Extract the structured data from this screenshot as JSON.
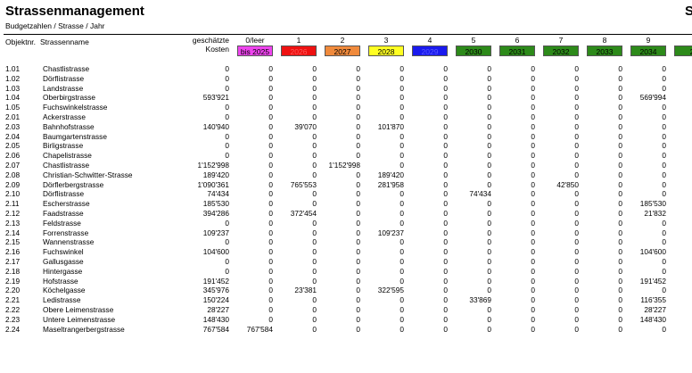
{
  "header": {
    "title": "Strassenmanagement",
    "title_right": "S",
    "subtitle": "Budgetzahlen / Strasse / Jahr"
  },
  "columns": {
    "objnr": "Objektnr.",
    "name": "Strassenname",
    "cost_line1": "geschätzte",
    "cost_line2": "Kosten",
    "periods": [
      {
        "num": "0/leer",
        "year": "bis 2025",
        "color": "#ee44ee",
        "text_color": "#000000"
      },
      {
        "num": "1",
        "year": "2026",
        "color": "#ee1111",
        "text_color": "#ff5a5a"
      },
      {
        "num": "2",
        "year": "2027",
        "color": "#f08a3c",
        "text_color": "#000000"
      },
      {
        "num": "3",
        "year": "2028",
        "color": "#ffff22",
        "text_color": "#000000"
      },
      {
        "num": "4",
        "year": "2029",
        "color": "#1a1aee",
        "text_color": "#5a5aff"
      },
      {
        "num": "5",
        "year": "2030",
        "color": "#2d8a1a",
        "text_color": "#000000"
      },
      {
        "num": "6",
        "year": "2031",
        "color": "#2d8a1a",
        "text_color": "#000000"
      },
      {
        "num": "7",
        "year": "2032",
        "color": "#2d8a1a",
        "text_color": "#000000"
      },
      {
        "num": "8",
        "year": "2033",
        "color": "#2d8a1a",
        "text_color": "#000000"
      },
      {
        "num": "9",
        "year": "2034",
        "color": "#2d8a1a",
        "text_color": "#000000"
      },
      {
        "num": "",
        "year": "2",
        "color": "#2d8a1a",
        "text_color": "#000000"
      }
    ]
  },
  "rows": [
    {
      "nr": "1.01",
      "name": "Chastlistrasse",
      "cost": "0",
      "v": [
        "0",
        "0",
        "0",
        "0",
        "0",
        "0",
        "0",
        "0",
        "0",
        "0"
      ]
    },
    {
      "nr": "1.02",
      "name": "Dörflistrasse",
      "cost": "0",
      "v": [
        "0",
        "0",
        "0",
        "0",
        "0",
        "0",
        "0",
        "0",
        "0",
        "0"
      ]
    },
    {
      "nr": "1.03",
      "name": "Landstrasse",
      "cost": "0",
      "v": [
        "0",
        "0",
        "0",
        "0",
        "0",
        "0",
        "0",
        "0",
        "0",
        "0"
      ]
    },
    {
      "nr": "1.04",
      "name": "Oberbirgstrasse",
      "cost": "593'921",
      "v": [
        "0",
        "0",
        "0",
        "0",
        "0",
        "0",
        "0",
        "0",
        "0",
        "569'994"
      ]
    },
    {
      "nr": "1.05",
      "name": "Fuchswinkelstrasse",
      "cost": "0",
      "v": [
        "0",
        "0",
        "0",
        "0",
        "0",
        "0",
        "0",
        "0",
        "0",
        "0"
      ]
    },
    {
      "nr": "2.01",
      "name": "Ackerstrasse",
      "cost": "0",
      "v": [
        "0",
        "0",
        "0",
        "0",
        "0",
        "0",
        "0",
        "0",
        "0",
        "0"
      ]
    },
    {
      "nr": "2.03",
      "name": "Bahnhofstrasse",
      "cost": "140'940",
      "v": [
        "0",
        "39'070",
        "0",
        "101'870",
        "0",
        "0",
        "0",
        "0",
        "0",
        "0"
      ]
    },
    {
      "nr": "2.04",
      "name": "Baumgartenstrasse",
      "cost": "0",
      "v": [
        "0",
        "0",
        "0",
        "0",
        "0",
        "0",
        "0",
        "0",
        "0",
        "0"
      ]
    },
    {
      "nr": "2.05",
      "name": "Birligstrasse",
      "cost": "0",
      "v": [
        "0",
        "0",
        "0",
        "0",
        "0",
        "0",
        "0",
        "0",
        "0",
        "0"
      ]
    },
    {
      "nr": "2.06",
      "name": "Chapelistrasse",
      "cost": "0",
      "v": [
        "0",
        "0",
        "0",
        "0",
        "0",
        "0",
        "0",
        "0",
        "0",
        "0"
      ]
    },
    {
      "nr": "2.07",
      "name": "Chastlistrasse",
      "cost": "1'152'998",
      "v": [
        "0",
        "0",
        "1'152'998",
        "0",
        "0",
        "0",
        "0",
        "0",
        "0",
        "0"
      ]
    },
    {
      "nr": "2.08",
      "name": "Christian-Schwitter-Strasse",
      "cost": "189'420",
      "v": [
        "0",
        "0",
        "0",
        "189'420",
        "0",
        "0",
        "0",
        "0",
        "0",
        "0"
      ]
    },
    {
      "nr": "2.09",
      "name": "Dörflerbergstrasse",
      "cost": "1'090'361",
      "v": [
        "0",
        "765'553",
        "0",
        "281'958",
        "0",
        "0",
        "0",
        "42'850",
        "0",
        "0"
      ]
    },
    {
      "nr": "2.10",
      "name": "Dörflistrasse",
      "cost": "74'434",
      "v": [
        "0",
        "0",
        "0",
        "0",
        "0",
        "74'434",
        "0",
        "0",
        "0",
        "0"
      ]
    },
    {
      "nr": "2.11",
      "name": "Escherstrasse",
      "cost": "185'530",
      "v": [
        "0",
        "0",
        "0",
        "0",
        "0",
        "0",
        "0",
        "0",
        "0",
        "185'530"
      ]
    },
    {
      "nr": "2.12",
      "name": "Faadstrasse",
      "cost": "394'286",
      "v": [
        "0",
        "372'454",
        "0",
        "0",
        "0",
        "0",
        "0",
        "0",
        "0",
        "21'832"
      ]
    },
    {
      "nr": "2.13",
      "name": "Feldstrasse",
      "cost": "0",
      "v": [
        "0",
        "0",
        "0",
        "0",
        "0",
        "0",
        "0",
        "0",
        "0",
        "0"
      ]
    },
    {
      "nr": "2.14",
      "name": "Forrenstrasse",
      "cost": "109'237",
      "v": [
        "0",
        "0",
        "0",
        "109'237",
        "0",
        "0",
        "0",
        "0",
        "0",
        "0"
      ]
    },
    {
      "nr": "2.15",
      "name": "Wannenstrasse",
      "cost": "0",
      "v": [
        "0",
        "0",
        "0",
        "0",
        "0",
        "0",
        "0",
        "0",
        "0",
        "0"
      ]
    },
    {
      "nr": "2.16",
      "name": "Fuchswinkel",
      "cost": "104'600",
      "v": [
        "0",
        "0",
        "0",
        "0",
        "0",
        "0",
        "0",
        "0",
        "0",
        "104'600"
      ]
    },
    {
      "nr": "2.17",
      "name": "Gallusgasse",
      "cost": "0",
      "v": [
        "0",
        "0",
        "0",
        "0",
        "0",
        "0",
        "0",
        "0",
        "0",
        "0"
      ]
    },
    {
      "nr": "2.18",
      "name": "Hintergasse",
      "cost": "0",
      "v": [
        "0",
        "0",
        "0",
        "0",
        "0",
        "0",
        "0",
        "0",
        "0",
        "0"
      ]
    },
    {
      "nr": "2.19",
      "name": "Hofstrasse",
      "cost": "191'452",
      "v": [
        "0",
        "0",
        "0",
        "0",
        "0",
        "0",
        "0",
        "0",
        "0",
        "191'452"
      ]
    },
    {
      "nr": "2.20",
      "name": "Köchelgasse",
      "cost": "345'976",
      "v": [
        "0",
        "23'381",
        "0",
        "322'595",
        "0",
        "0",
        "0",
        "0",
        "0",
        "0"
      ]
    },
    {
      "nr": "2.21",
      "name": "Ledistrasse",
      "cost": "150'224",
      "v": [
        "0",
        "0",
        "0",
        "0",
        "0",
        "33'869",
        "0",
        "0",
        "0",
        "116'355"
      ]
    },
    {
      "nr": "2.22",
      "name": "Obere Leimenstrasse",
      "cost": "28'227",
      "v": [
        "0",
        "0",
        "0",
        "0",
        "0",
        "0",
        "0",
        "0",
        "0",
        "28'227"
      ]
    },
    {
      "nr": "2.23",
      "name": "Untere Leimenstrasse",
      "cost": "148'430",
      "v": [
        "0",
        "0",
        "0",
        "0",
        "0",
        "0",
        "0",
        "0",
        "0",
        "148'430"
      ]
    },
    {
      "nr": "2.24",
      "name": "Maseltrangerbergstrasse",
      "cost": "767'584",
      "v": [
        "767'584",
        "0",
        "0",
        "0",
        "0",
        "0",
        "0",
        "0",
        "0",
        "0"
      ]
    }
  ]
}
